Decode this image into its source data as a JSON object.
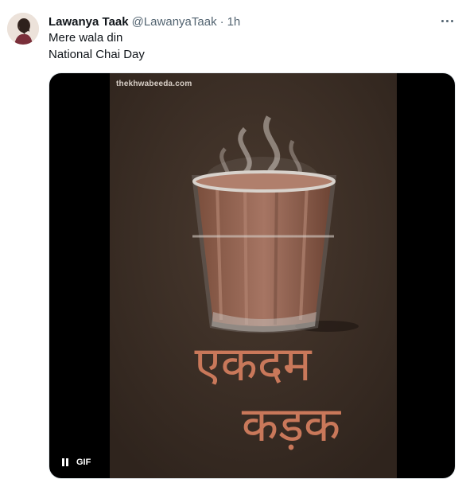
{
  "tweet": {
    "display_name": "Lawanya Taak",
    "handle": "@LawanyaTaak",
    "separator": "·",
    "time": "1h",
    "lines": [
      "Mere wala din",
      "National Chai Day"
    ]
  },
  "media": {
    "watermark": "thekhwabeeda.com",
    "gif_label": "GIF",
    "caption_line1": "एकदम",
    "caption_line2": "कड़क"
  },
  "icons": {
    "more": "more-options-icon",
    "pause": "pause-icon",
    "tea_glass": "chai-glass-illustration"
  },
  "colors": {
    "text": "#0f1419",
    "secondary": "#536471",
    "gif_background": "#3b2d24",
    "caption": "#c9785a"
  }
}
